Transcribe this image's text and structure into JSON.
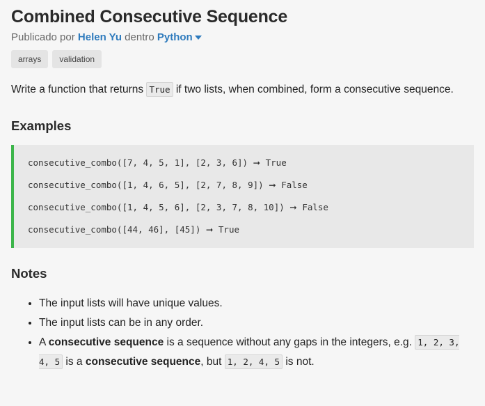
{
  "title": "Combined Consecutive Sequence",
  "byline": {
    "prefix": "Publicado por",
    "author": "Helen Yu",
    "middle": "dentro",
    "language": "Python"
  },
  "tags": [
    "arrays",
    "validation"
  ],
  "description": {
    "before": "Write a function that returns",
    "code": "True",
    "after": "if two lists, when combined, form a consecutive sequence."
  },
  "examples_heading": "Examples",
  "examples": [
    {
      "call": "consecutive_combo([7, 4, 5, 1], [2, 3, 6])",
      "arrow": "➞",
      "result": "True"
    },
    {
      "call": "consecutive_combo([1, 4, 6, 5], [2, 7, 8, 9])",
      "arrow": "➞",
      "result": "False"
    },
    {
      "call": "consecutive_combo([1, 4, 5, 6], [2, 3, 7, 8, 10])",
      "arrow": "➞",
      "result": "False"
    },
    {
      "call": "consecutive_combo([44, 46], [45])",
      "arrow": "➞",
      "result": "True"
    }
  ],
  "notes_heading": "Notes",
  "notes": {
    "item1": "The input lists will have unique values.",
    "item2": "The input lists can be in any order.",
    "item3": {
      "a": "A",
      "b": "consecutive sequence",
      "c": "is a sequence without any gaps in the integers, e.g.",
      "code1": "1, 2, 3, 4, 5",
      "d": "is a",
      "e": "consecutive sequence",
      "f": ", but",
      "code2": "1, 2, 4, 5",
      "g": "is not."
    }
  },
  "colors": {
    "link": "#2f7bbd",
    "code_border": "#3cb54a",
    "background": "#f6f6f6"
  }
}
